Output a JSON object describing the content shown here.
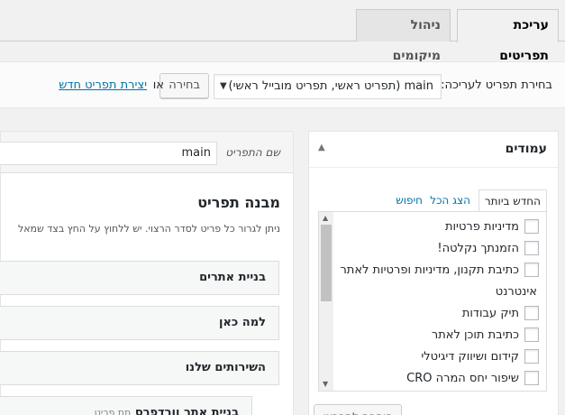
{
  "tabs": {
    "edit_menus": "עריכת תפריטים",
    "manage_locations": "ניהול מיקומים"
  },
  "select_bar": {
    "label": "בחירת תפריט לעריכה:",
    "selected_menu": "main (תפריט ראשי, תפריט מובייל ראשי)",
    "select_button": "בחירה",
    "or_text": "או",
    "create_link": "יצירת תפריט חדש"
  },
  "pages_box": {
    "title": "עמודים",
    "tabs": {
      "recent": "החדש ביותר",
      "view_all": "הצג הכל",
      "search": "חיפוש"
    },
    "items": [
      "מדיניות פרטיות",
      "הזמנתך נקלטה!",
      "כתיבת תקנון, מדיניות ופרטיות לאתר",
      "אינטרנט",
      "תיק עבודות",
      "כתיבת תוכן לאתר",
      "קידום ושיווק דיגיטלי",
      "שיפור יחס המרה CRO"
    ],
    "add_button": "הוספה לתפריט"
  },
  "menu_panel": {
    "name_label": "שם התפריט",
    "name_value": "main",
    "structure_title": "מבנה תפריט",
    "structure_desc": "ניתן לגרור כל פריט לסדר הרצוי. יש ללחוץ על החץ בצד שמאל",
    "items": [
      "בניית אתרים",
      "למה כאן",
      "השירותים שלנו",
      "בניית אתר וורדפרס"
    ],
    "sub_item_type": "תת פריט"
  }
}
